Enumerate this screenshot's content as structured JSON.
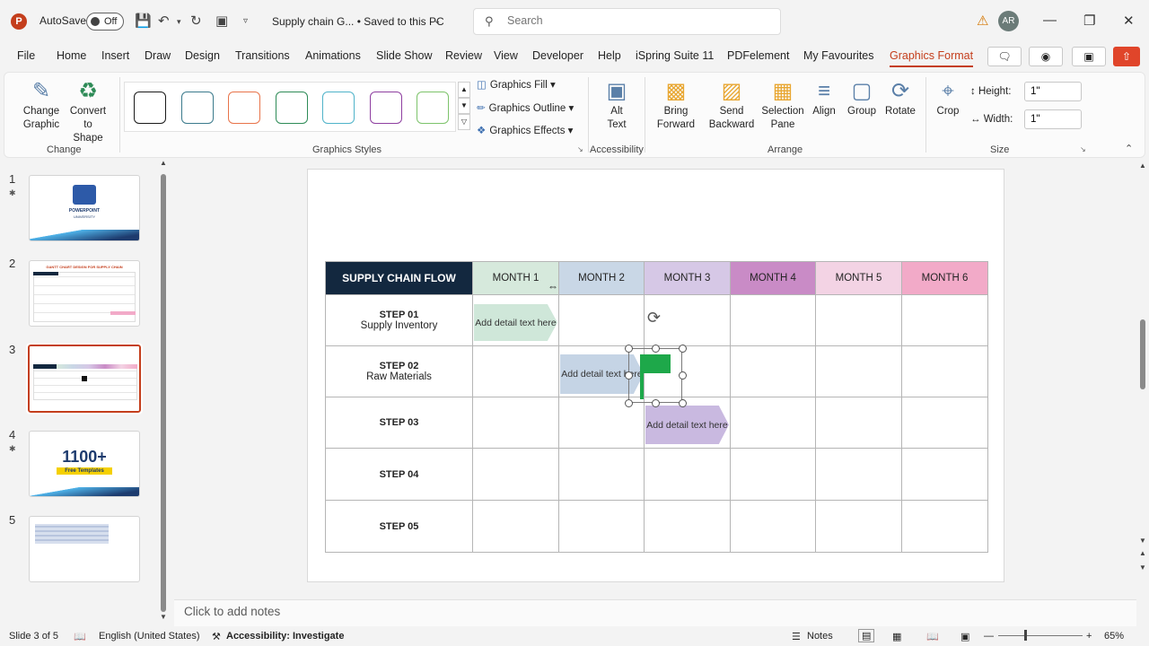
{
  "titlebar": {
    "app_logo": "P",
    "autosave_label": "AutoSave",
    "autosave_state": "Off",
    "doc_title": "Supply chain G... • Saved to this PC",
    "search_placeholder": "Search",
    "avatar_initials": "AR",
    "icons": [
      "save-icon",
      "undo-icon",
      "redo-icon",
      "present-icon",
      "customize-icon",
      "warning-icon",
      "minimize-icon",
      "restore-icon",
      "close-icon"
    ]
  },
  "tabs": [
    "File",
    "Home",
    "Insert",
    "Draw",
    "Design",
    "Transitions",
    "Animations",
    "Slide Show",
    "Review",
    "View",
    "Developer",
    "Help",
    "iSpring Suite 11",
    "PDFelement",
    "My Favourites",
    "Graphics Format"
  ],
  "active_tab": "Graphics Format",
  "ribbon": {
    "change_graphic": "Change Graphic",
    "convert_to_shape": "Convert to Shape",
    "group_change": "Change",
    "group_styles": "Graphics Styles",
    "style_colors": [
      "#1a1a1a",
      "#3b7a8c",
      "#e8734a",
      "#2e8b57",
      "#4fb3c9",
      "#8e3fa0",
      "#7dc36b"
    ],
    "graphics_fill": "Graphics Fill",
    "graphics_outline": "Graphics Outline",
    "graphics_effects": "Graphics Effects",
    "alt_text": "Alt Text",
    "group_accessibility": "Accessibility",
    "bring_forward": "Bring Forward",
    "send_backward": "Send Backward",
    "selection_pane": "Selection Pane",
    "align": "Align",
    "group": "Group",
    "rotate": "Rotate",
    "group_arrange": "Arrange",
    "crop": "Crop",
    "height_label": "Height:",
    "height_value": "1\"",
    "width_label": "Width:",
    "width_value": "1\"",
    "group_size": "Size"
  },
  "thumbnails": [
    {
      "num": "1",
      "starred": true
    },
    {
      "num": "2",
      "starred": false
    },
    {
      "num": "3",
      "starred": false,
      "active": true
    },
    {
      "num": "4",
      "starred": true
    },
    {
      "num": "5",
      "starred": false
    }
  ],
  "thumb_text": {
    "t1_a": "POWERPOINT",
    "t1_b": "UNIVERSITY",
    "t2_title": "GANTT CHART DESIGN FOR SUPPLY CHAIN",
    "t4_num": "1100+",
    "t4_sub": "Free Templates"
  },
  "gantt": {
    "header": "SUPPLY CHAIN FLOW",
    "months": [
      "MONTH 1",
      "MONTH 2",
      "MONTH 3",
      "MONTH 4",
      "MONTH 5",
      "MONTH 6"
    ],
    "month_colors": [
      "#d6e9dc",
      "#c9d7e6",
      "#d6c8e6",
      "#c98bc6",
      "#f3d3e4",
      "#f2aac8"
    ],
    "steps": [
      {
        "title": "STEP 01",
        "sub": "Supply Inventory"
      },
      {
        "title": "STEP 02",
        "sub": "Raw Materials"
      },
      {
        "title": "STEP 03",
        "sub": ""
      },
      {
        "title": "STEP 04",
        "sub": ""
      },
      {
        "title": "STEP 05",
        "sub": ""
      }
    ],
    "bars": [
      {
        "text": "Add detail text here",
        "color": "#cfe7d9"
      },
      {
        "text": "Add detail text here",
        "color": "#c5d4e5"
      },
      {
        "text": "Add detail text here",
        "color": "#c9b9e0"
      }
    ],
    "flag_color": "#1ea84a"
  },
  "notes_placeholder": "Click to add notes",
  "status": {
    "slide": "Slide 3 of 5",
    "language": "English (United States)",
    "accessibility": "Accessibility: Investigate",
    "notes": "Notes",
    "zoom": "65%"
  }
}
